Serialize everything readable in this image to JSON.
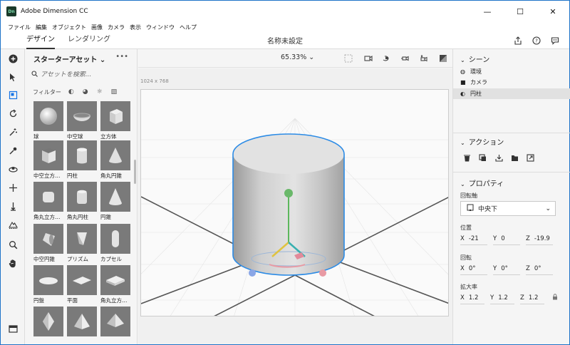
{
  "window": {
    "title": "Adobe Dimension CC",
    "app_icon": "Dn",
    "controls": [
      "minimize-icon",
      "maximize-icon",
      "close-icon"
    ]
  },
  "menu": [
    "ファイル",
    "編集",
    "オブジェクト",
    "画像",
    "カメラ",
    "表示",
    "ウィンドウ",
    "ヘルプ"
  ],
  "header": {
    "tabs": [
      "デザイン",
      "レンダリング"
    ],
    "document_title": "名称未設定",
    "icons": [
      "share-icon",
      "help-icon",
      "feedback-icon"
    ]
  },
  "toolbar": {
    "tools": [
      "add-icon",
      "select-icon",
      "move-icon",
      "rotate-icon",
      "magic-wand-icon",
      "eyedropper-icon",
      "orbit-icon",
      "pan-icon",
      "dolly-icon",
      "horizon-icon",
      "zoom-icon",
      "hand-icon",
      "panel-toggle-icon"
    ]
  },
  "assets": {
    "title": "スターターアセット ⌄",
    "more": "•••",
    "search_placeholder": "アセットを検索...",
    "filter_label": "フィルター",
    "items": [
      {
        "label": "球",
        "shape": "sphere"
      },
      {
        "label": "中空球",
        "shape": "hollow-sphere"
      },
      {
        "label": "立方体",
        "shape": "cube"
      },
      {
        "label": "中空立方…",
        "shape": "hollow-cube"
      },
      {
        "label": "円柱",
        "shape": "cylinder"
      },
      {
        "label": "角丸円錐",
        "shape": "rounded-cone"
      },
      {
        "label": "角丸立方…",
        "shape": "rounded-cube"
      },
      {
        "label": "角丸円柱",
        "shape": "rounded-cylinder"
      },
      {
        "label": "円錐",
        "shape": "cone"
      },
      {
        "label": "中空円錐",
        "shape": "hollow-cone"
      },
      {
        "label": "プリズム",
        "shape": "prism"
      },
      {
        "label": "カプセル",
        "shape": "capsule"
      },
      {
        "label": "円盤",
        "shape": "disc"
      },
      {
        "label": "平面",
        "shape": "plane"
      },
      {
        "label": "角丸立方…",
        "shape": "rounded-box"
      },
      {
        "label": "",
        "shape": "octahedron"
      },
      {
        "label": "",
        "shape": "pyramid"
      },
      {
        "label": "",
        "shape": "pyramid2"
      }
    ]
  },
  "viewport": {
    "zoom": "65.33% ⌄",
    "canvas_size": "1024 x 768"
  },
  "scene": {
    "title": "シーン",
    "items": [
      {
        "label": "環境",
        "icon": "environment-icon"
      },
      {
        "label": "カメラ",
        "icon": "camera-icon"
      },
      {
        "label": "円柱",
        "icon": "cylinder-icon",
        "selected": true
      }
    ]
  },
  "actions": {
    "title": "アクション",
    "icons": [
      "delete-icon",
      "duplicate-icon",
      "drop-to-ground-icon",
      "group-icon",
      "export-icon"
    ]
  },
  "properties": {
    "title": "プロパティ",
    "pivot_label": "回転軸",
    "pivot_value": "中央下",
    "position_label": "位置",
    "position": {
      "x": "-21",
      "y": "0",
      "z": "-19.9"
    },
    "rotation_label": "回転",
    "rotation": {
      "x": "0°",
      "y": "0°",
      "z": "0°"
    },
    "scale_label": "拡大率",
    "scale": {
      "x": "1.2",
      "y": "1.2",
      "z": "1.2"
    }
  },
  "colors": {
    "accent": "#1473e6",
    "selection_outline": "#2b8be6",
    "thumb_bg": "#7a7a7a"
  }
}
